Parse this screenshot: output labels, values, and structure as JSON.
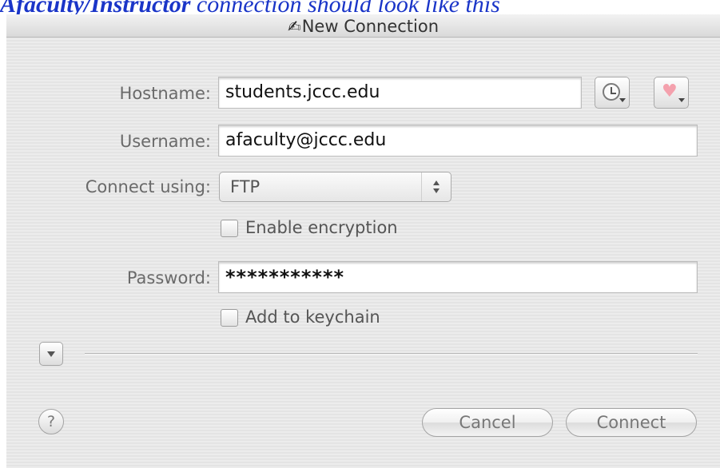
{
  "caption": {
    "bold_part": "Afaculty/Instructor",
    "rest": " connection should look like this"
  },
  "window": {
    "title": "New Connection"
  },
  "form": {
    "hostname_label": "Hostname:",
    "hostname_value": "students.jccc.edu",
    "username_label": "Username:",
    "username_value": "afaculty@jccc.edu",
    "connect_using_label": "Connect using:",
    "connect_using_value": "FTP",
    "enable_encryption_label": "Enable encryption",
    "enable_encryption_checked": false,
    "password_label": "Password:",
    "password_value": "***********",
    "add_to_keychain_label": "Add to keychain",
    "add_to_keychain_checked": false
  },
  "buttons": {
    "cancel": "Cancel",
    "connect": "Connect",
    "help": "?"
  },
  "icons": {
    "title": "handwriting-icon",
    "history": "clock-icon",
    "favorites": "heart-icon",
    "disclosure": "triangle-down-icon",
    "help": "question-mark-icon"
  },
  "colors": {
    "caption": "#1a35c8",
    "heart": "#f4a1ad"
  }
}
